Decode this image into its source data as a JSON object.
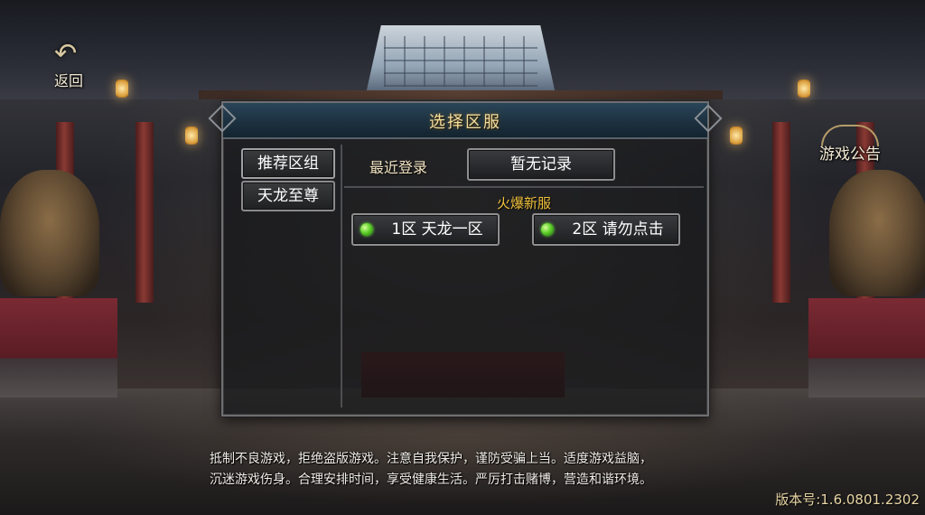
{
  "top_bar": {
    "back_label": "返回",
    "notice_label": "游戏公告"
  },
  "dialog": {
    "title": "选择区服",
    "groups": [
      {
        "label": "推荐区组",
        "selected": true
      },
      {
        "label": "天龙至尊",
        "selected": false
      }
    ],
    "recent_label": "最近登录",
    "recent_value": "暂无记录",
    "hot_title": "火爆新服",
    "servers": [
      {
        "name": "1区 天龙一区",
        "status_color": "#5fd12b"
      },
      {
        "name": "2区 请勿点击",
        "status_color": "#5fd12b"
      }
    ]
  },
  "footer": {
    "notice_line1": "抵制不良游戏，拒绝盗版游戏。注意自我保护，谨防受骗上当。适度游戏益脑，",
    "notice_line2": "沉迷游戏伤身。合理安排时间，享受健康生活。严厉打击赌博，营造和谐环境。",
    "version": "版本号:1.6.0801.2302"
  },
  "icons": {
    "back": "back-arrow-icon",
    "server_status": "green-dot-icon"
  }
}
